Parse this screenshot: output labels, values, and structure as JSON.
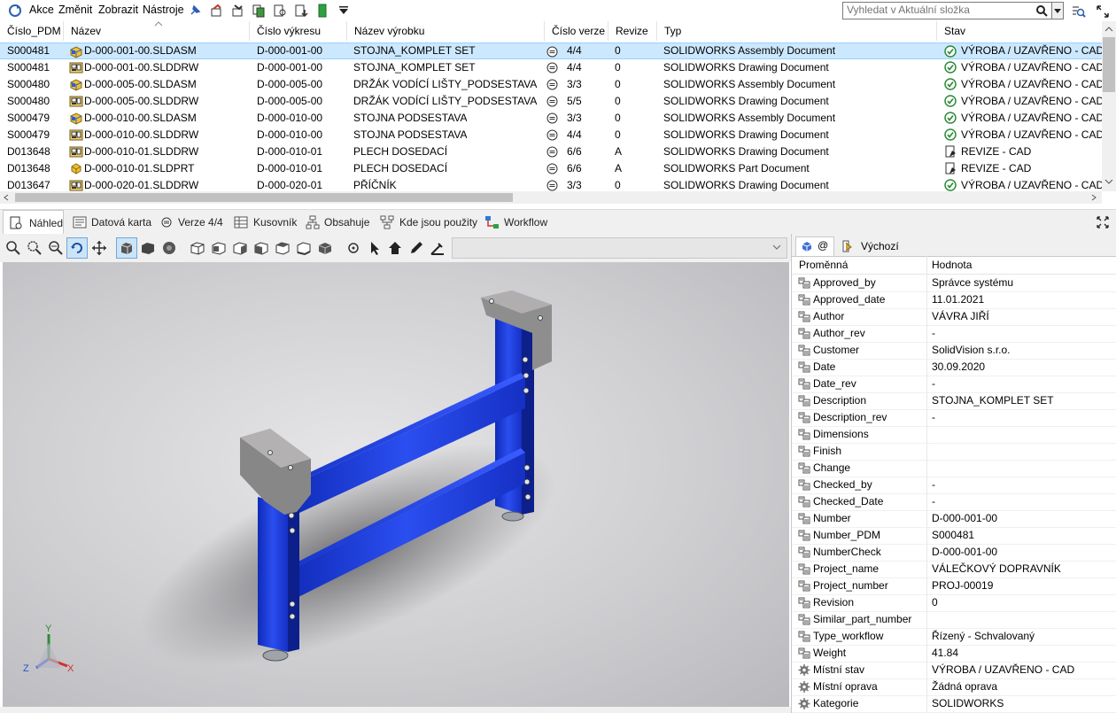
{
  "menu": {
    "items": [
      "Akce",
      "Změnit",
      "Zobrazit",
      "Nástroje"
    ]
  },
  "search": {
    "placeholder": "Vyhledat v Aktuální složka"
  },
  "table": {
    "columns": [
      "Číslo_PDM",
      "Název",
      "Číslo výkresu",
      "Název výrobku",
      "Číslo verze",
      "Revize",
      "Typ",
      "Stav"
    ],
    "rows": [
      {
        "pdm": "S000481",
        "name": "D-000-001-00.SLDASM",
        "drawing": "D-000-001-00",
        "product": "STOJNA_KOMPLET SET",
        "version": "4/4",
        "rev": "0",
        "type": "SOLIDWORKS Assembly Document",
        "state": "VÝROBA / UZAVŘENO - CAD",
        "icon": "assembly",
        "status": "ok"
      },
      {
        "pdm": "S000481",
        "name": "D-000-001-00.SLDDRW",
        "drawing": "D-000-001-00",
        "product": "STOJNA_KOMPLET SET",
        "version": "4/4",
        "rev": "0",
        "type": "SOLIDWORKS Drawing Document",
        "state": "VÝROBA / UZAVŘENO - CAD",
        "icon": "drawing",
        "status": "ok"
      },
      {
        "pdm": "S000480",
        "name": "D-000-005-00.SLDASM",
        "drawing": "D-000-005-00",
        "product": "DRŽÁK VODÍCÍ LIŠTY_PODSESTAVA",
        "version": "3/3",
        "rev": "0",
        "type": "SOLIDWORKS Assembly Document",
        "state": "VÝROBA / UZAVŘENO - CAD",
        "icon": "assembly",
        "status": "ok"
      },
      {
        "pdm": "S000480",
        "name": "D-000-005-00.SLDDRW",
        "drawing": "D-000-005-00",
        "product": "DRŽÁK VODÍCÍ LIŠTY_PODSESTAVA",
        "version": "5/5",
        "rev": "0",
        "type": "SOLIDWORKS Drawing Document",
        "state": "VÝROBA / UZAVŘENO - CAD",
        "icon": "drawing",
        "status": "ok"
      },
      {
        "pdm": "S000479",
        "name": "D-000-010-00.SLDASM",
        "drawing": "D-000-010-00",
        "product": "STOJNA PODSESTAVA",
        "version": "3/3",
        "rev": "0",
        "type": "SOLIDWORKS Assembly Document",
        "state": "VÝROBA / UZAVŘENO - CAD",
        "icon": "assembly",
        "status": "ok"
      },
      {
        "pdm": "S000479",
        "name": "D-000-010-00.SLDDRW",
        "drawing": "D-000-010-00",
        "product": "STOJNA PODSESTAVA",
        "version": "4/4",
        "rev": "0",
        "type": "SOLIDWORKS Drawing Document",
        "state": "VÝROBA / UZAVŘENO - CAD",
        "icon": "drawing",
        "status": "ok"
      },
      {
        "pdm": "D013648",
        "name": "D-000-010-01.SLDDRW",
        "drawing": "D-000-010-01",
        "product": "PLECH DOSEDACÍ",
        "version": "6/6",
        "rev": "A",
        "type": "SOLIDWORKS Drawing Document",
        "state": "REVIZE - CAD",
        "icon": "drawing",
        "status": "rev"
      },
      {
        "pdm": "D013648",
        "name": "D-000-010-01.SLDPRT",
        "drawing": "D-000-010-01",
        "product": "PLECH DOSEDACÍ",
        "version": "6/6",
        "rev": "A",
        "type": "SOLIDWORKS Part Document",
        "state": "REVIZE - CAD",
        "icon": "part",
        "status": "rev"
      },
      {
        "pdm": "D013647",
        "name": "D-000-020-01.SLDDRW",
        "drawing": "D-000-020-01",
        "product": "PŘÍČNÍK",
        "version": "3/3",
        "rev": "0",
        "type": "SOLIDWORKS Drawing Document",
        "state": "VÝROBA / UZAVŘENO - CAD",
        "icon": "drawing",
        "status": "ok"
      }
    ]
  },
  "tabs": [
    "Náhled",
    "Datová karta",
    "Verze 4/4",
    "Kusovník",
    "Obsahuje",
    "Kde jsou použity",
    "Workflow"
  ],
  "props": {
    "tab_at": "@",
    "tab_config": "Výchozí",
    "col_var": "Proměnná",
    "col_val": "Hodnota",
    "rows": [
      {
        "name": "Approved_by",
        "value": "Správce systému"
      },
      {
        "name": "Approved_date",
        "value": "11.01.2021"
      },
      {
        "name": "Author",
        "value": "VÁVRA JIŘÍ"
      },
      {
        "name": "Author_rev",
        "value": "-"
      },
      {
        "name": "Customer",
        "value": "SolidVision s.r.o."
      },
      {
        "name": "Date",
        "value": "30.09.2020"
      },
      {
        "name": "Date_rev",
        "value": "-"
      },
      {
        "name": "Description",
        "value": "STOJNA_KOMPLET SET"
      },
      {
        "name": "Description_rev",
        "value": "-"
      },
      {
        "name": "Dimensions",
        "value": ""
      },
      {
        "name": "Finish",
        "value": ""
      },
      {
        "name": "Change",
        "value": ""
      },
      {
        "name": "Checked_by",
        "value": "-"
      },
      {
        "name": "Checked_Date",
        "value": "-"
      },
      {
        "name": "Number",
        "value": "D-000-001-00"
      },
      {
        "name": "Number_PDM",
        "value": "S000481"
      },
      {
        "name": "NumberCheck",
        "value": "D-000-001-00"
      },
      {
        "name": "Project_name",
        "value": "VÁLEČKOVÝ DOPRAVNÍK"
      },
      {
        "name": "Project_number",
        "value": "PROJ-00019"
      },
      {
        "name": "Revision",
        "value": "0"
      },
      {
        "name": "Similar_part_number",
        "value": ""
      },
      {
        "name": "Type_workflow",
        "value": "Řízený - Schvalovaný"
      },
      {
        "name": "Weight",
        "value": "41.84"
      },
      {
        "name": "Místní stav",
        "value": "VÝROBA / UZAVŘENO - CAD"
      },
      {
        "name": "Místní oprava",
        "value": "Žádná oprava"
      },
      {
        "name": "Kategorie",
        "value": "SOLIDWORKS"
      }
    ]
  },
  "triad": {
    "x": "X",
    "y": "Y",
    "z": "Z"
  },
  "colors": {
    "selection": "#cce8ff",
    "frame_blue": "#1f3fd6",
    "plate_grey": "#8c8c8c",
    "status_green": "#2e8b3a"
  }
}
